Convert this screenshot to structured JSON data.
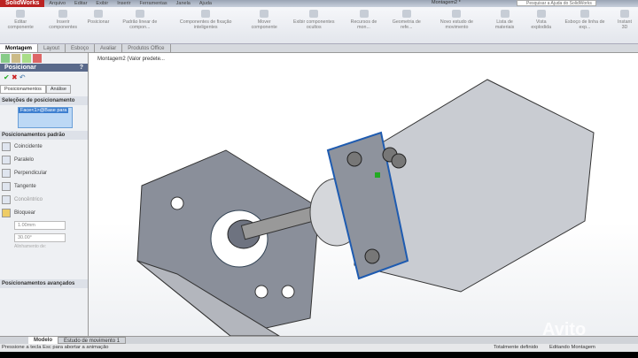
{
  "app": {
    "logo": "SolidWorks",
    "menu": [
      "Arquivo",
      "Editar",
      "Exibir",
      "Inserir",
      "Ferramentas",
      "Janela",
      "Ajuda"
    ],
    "doc_title": "Montagem2 *",
    "search_placeholder": "Pesquisar a Ajuda do SolidWorks"
  },
  "ribbon": [
    "Editar componente",
    "Inserir componentes",
    "Posicionar",
    "Padrão linear de compon...",
    "Componentes de fixação inteligentes",
    "Mover componente",
    "Exibir componentes ocultos",
    "Recursos de mon...",
    "Geometria de refe...",
    "Novo estudo de movimento",
    "Lista de materiais",
    "Vista explodida",
    "Esboço de linha de exp...",
    "Instant 3D"
  ],
  "tabs": [
    "Montagem",
    "Layout",
    "Esboço",
    "Avaliar",
    "Produtos Office"
  ],
  "panel": {
    "title": "Posicionar",
    "help": "?",
    "subtabs": [
      "Posicionamentos",
      "Análise"
    ],
    "sel_section": "Seleções de posicionamento",
    "selection": "Face<1>@Base para",
    "std_section": "Posicionamentos padrão",
    "mates": [
      "Coincidente",
      "Paralelo",
      "Perpendicular",
      "Tangente",
      "Concêntrico",
      "Bloquear"
    ],
    "distance": "1.00mm",
    "angle": "30.00°",
    "align_label": "Alinhamento de:",
    "adv_section": "Posicionamentos avançados"
  },
  "viewport": {
    "tree_item": "Montagem2 (Valor predete..."
  },
  "bottom_tabs": [
    "Modelo",
    "Estudo de movimento 1"
  ],
  "status": {
    "left": "Pressione a tecla Esc para abortar a animação",
    "defined": "Totalmente definido",
    "editing": "Editando Montagem"
  },
  "watermark": "Avito"
}
